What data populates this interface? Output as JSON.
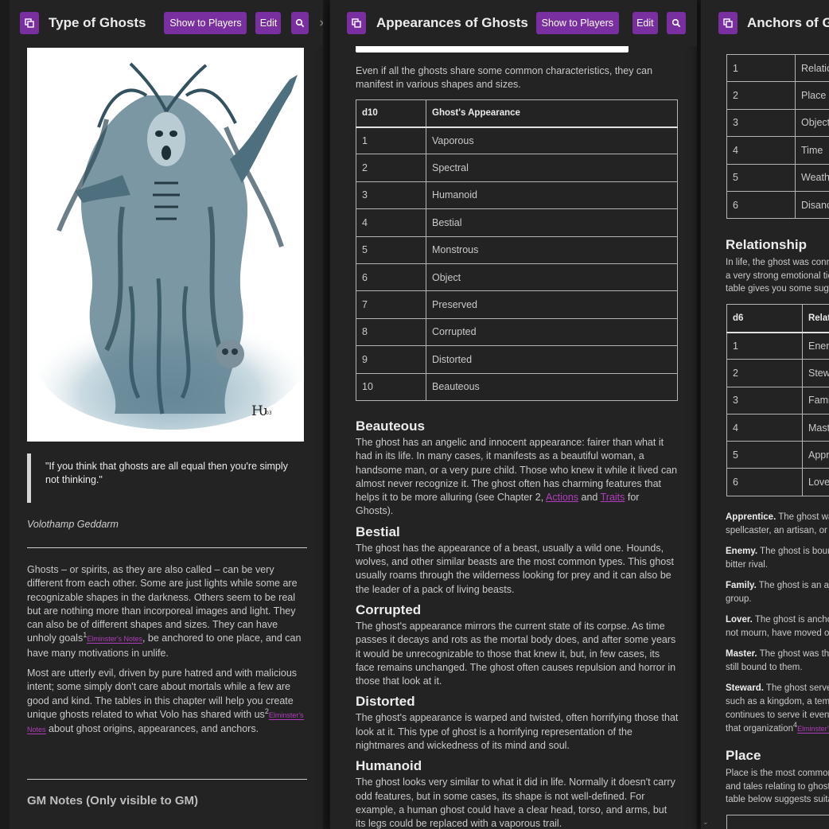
{
  "panel1": {
    "title": "Type of Ghosts",
    "show_button": "Show to Players",
    "edit_button": "Edit",
    "close": "×",
    "quote": "\"If you think that ghosts are all equal then you're simply not thinking.\"",
    "attribution": "Volothamp Geddarm",
    "para1_a": "Ghosts – or spirits, as they are also called – can be very different from each other. Some are just lights while some are recognizable shapes in the darkness. Others seem to be real but are nothing more than incorporeal images and light. They can also be of different shapes and sizes. They can have unholy goals",
    "fn1": "1",
    "note1": "Elminster's Notes",
    "para1_b": ", be anchored to one place, and can have many motivations in unlife.",
    "para2_a": "Most are utterly evil, driven by pure hatred and with malicious intent; some simply don't care about mortals while a few are good and kind. The tables in this chapter will help you create unique ghosts related to what Volo has shared with us",
    "fn2": "2",
    "note2a": "Elminster's",
    "note2b": "Notes",
    "para2_b": " about ghost origins, appearances, and anchors.",
    "gm_notes": "GM Notes (Only visible to GM)"
  },
  "panel2": {
    "title": "Appearances of Ghosts",
    "show_button": "Show to Players",
    "edit_button": "Edit",
    "close": "×",
    "intro": "Even if all the ghosts share some common characteristics, they can manifest in various shapes and sizes.",
    "table_headers": [
      "d10",
      "Ghost's Appearance"
    ],
    "table_rows": [
      [
        "1",
        "Vaporous"
      ],
      [
        "2",
        "Spectral"
      ],
      [
        "3",
        "Humanoid"
      ],
      [
        "4",
        "Bestial"
      ],
      [
        "5",
        "Monstrous"
      ],
      [
        "6",
        "Object"
      ],
      [
        "7",
        "Preserved"
      ],
      [
        "8",
        "Corrupted"
      ],
      [
        "9",
        "Distorted"
      ],
      [
        "10",
        "Beauteous"
      ]
    ],
    "sections": [
      {
        "heading": "Beauteous",
        "text_a": "The ghost has an angelic and innocent appearance: fairer than what it had in its life. In many cases, it manifests as a beautiful woman, a handsome man, or a very pure child. Those who knew it while it lived can almost never recognize it. The ghost often has charming features that helps it to be more alluring (see Chapter 2, ",
        "link1": "Actions",
        "and": " and ",
        "link2": "Traits",
        "text_b": " for Ghosts)."
      },
      {
        "heading": "Bestial",
        "text": "The ghost has the appearance of a beast, usually a wild one. Hounds, wolves, and other similar beasts are the most common types. This ghost usually roams through the wilderness looking for prey and it can also be the leader of a pack of living beasts."
      },
      {
        "heading": "Corrupted",
        "text": "The ghost's appearance mirrors the current state of its corpse. As time passes it decays and rots as the mortal body does, and after some years it would be unrecognizable to those that knew it, but, in few cases, its face remains unchanged. The ghost often causes repulsion and horror in those that look at it."
      },
      {
        "heading": "Distorted",
        "text": "The ghost's appearance is warped and twisted, often horrifying those that look at it. This type of ghost is a horrifying representation of the nightmares and wickedness of its mind and soul."
      },
      {
        "heading": "Humanoid",
        "text": "The ghost looks very similar to what it did in life. Normally it doesn't carry odd features, but in some cases, its shape is not well-defined. For example, a human ghost could have a clear head, torso, and arms, but its legs could be replaced with a vaporous trail."
      }
    ]
  },
  "panel3": {
    "title": "Anchors of Ghosts",
    "table1_rows": [
      [
        "1",
        "Relationship"
      ],
      [
        "2",
        "Place"
      ],
      [
        "3",
        "Object"
      ],
      [
        "4",
        "Time"
      ],
      [
        "5",
        "Weather"
      ],
      [
        "6",
        "Disance"
      ]
    ],
    "relationship_heading": "Relationship",
    "relationship_text": "In life, the ghost was connected to others by a very strong emotional tie. The following table gives you some suggestions.",
    "table2_headers": [
      "d6",
      "Relationship"
    ],
    "table2_rows": [
      [
        "1",
        "Enemy"
      ],
      [
        "2",
        "Steward"
      ],
      [
        "3",
        "Family"
      ],
      [
        "4",
        "Master"
      ],
      [
        "5",
        "Apprentice"
      ],
      [
        "6",
        "Lover"
      ]
    ],
    "defs": [
      {
        "term": "Apprentice.",
        "text": " The ghost was the apprentice of a spellcaster, an artisan, or another master."
      },
      {
        "term": "Enemy.",
        "text": " The ghost is bound to its murderer or a bitter rival."
      },
      {
        "term": "Family.",
        "text": " The ghost is an ancestor of a family group."
      },
      {
        "term": "Lover.",
        "text": " The ghost is anchored to the one it could not mourn, have moved on, or be forgotten."
      },
      {
        "term": "Master.",
        "text": " The ghost was the master of someone still bound to them."
      },
      {
        "term": "Steward.",
        "text": " The ghost served an organization such as a kingdom, a temple, a guild, and still continues to serve it even now as a steward of that organization"
      }
    ],
    "fn4": "4",
    "note4": "Elminster's Notes",
    "place_heading": "Place",
    "place_text": "Place is the most common anchor of ghosts, and tales relating to ghosts tied to places. The table below suggests suitable places."
  }
}
